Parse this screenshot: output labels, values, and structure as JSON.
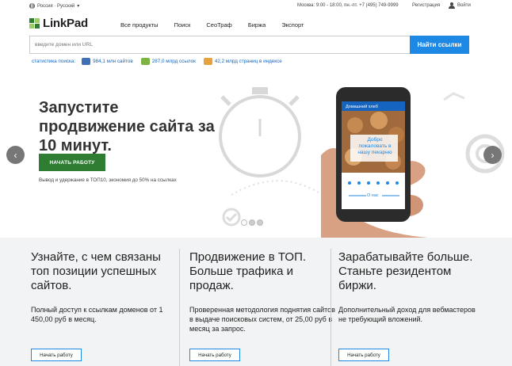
{
  "topbar": {
    "lang": "Россия · Русский",
    "contact": "Москва: 9:00 - 18:00, пн.-пт. +7 (495) 749-9999",
    "register": "Регистрация",
    "login": "Войти"
  },
  "header": {
    "logo": "LinkPad",
    "nav": [
      "Все продукты",
      "Поиск",
      "СеоТраф",
      "Биржа",
      "Экспорт"
    ]
  },
  "search": {
    "placeholder": "введите домен или URL",
    "button": "Найти ссылки"
  },
  "stats": {
    "label": "статистика поиска:",
    "items": [
      {
        "text": "984,1 млн сайтов",
        "color": "#3f6fb5"
      },
      {
        "text": "287,0 млрд ссылок",
        "color": "#7cb342"
      },
      {
        "text": "42,2 млрд страниц в индексе",
        "color": "#e6a23c"
      }
    ]
  },
  "hero": {
    "title": "Запустите продвижение сайта за 10 минут.",
    "button": "НАЧАТЬ РАБОТУ",
    "subtitle": "Вывод и удержание в ТОП10, экономия до 50% на ссылках",
    "phone_header": "Домашний хлеб",
    "phone_banner": "Добро пожаловать в нашу пекарню",
    "phone_link": "О нас"
  },
  "features": [
    {
      "title": "Узнайте, с чем связаны топ позиции успешных сайтов.",
      "text": "Полный доступ к ссылкам доменов от 1 450,00 руб в месяц.",
      "button": "Начать работу"
    },
    {
      "title": "Продвижение в ТОП. Больше трафика и продаж.",
      "text": "Проверенная методология поднятия сайтов в выдаче поисковых систем, от 25,00 руб в месяц за запрос.",
      "button": "Начать работу"
    },
    {
      "title": "Зарабатывайте больше. Станьте резидентом биржи.",
      "text": "Дополнительный доход для вебмастеров не требующий вложений.",
      "button": "Начать работу"
    }
  ],
  "colors": {
    "accent": "#1e88e5",
    "green": "#2e7d32"
  }
}
